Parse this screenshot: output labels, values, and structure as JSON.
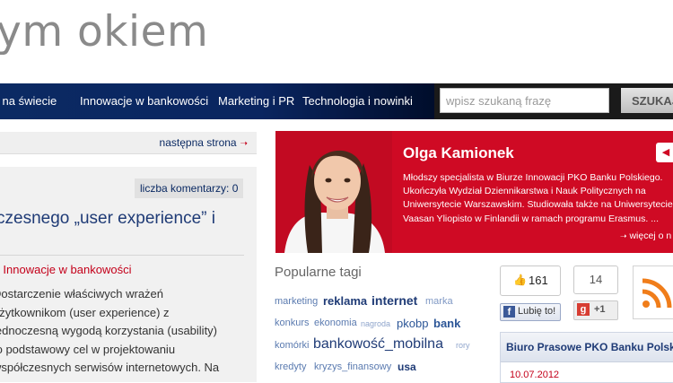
{
  "site": {
    "title": "ym okiem"
  },
  "nav": {
    "items": [
      "i na świecie",
      "Innowacje w bankowości",
      "Marketing i PR",
      "Technologia i nowinki"
    ]
  },
  "search": {
    "placeholder": "wpisz szukaną frazę",
    "button_label": "SZUKAJ"
  },
  "pager": {
    "next_label": "następna strona"
  },
  "article": {
    "comments_label": "liczba komentarzy: 0",
    "title": "czesnego „user experience” i",
    "category_prefix": "ii",
    "category": "Innowacje w bankowości",
    "excerpt_lines": [
      "Dostarczenie właściwych wrażeń",
      "użytkownikom (user experience) z",
      "jednoczesną wygodą korzystania (usability)",
      "to podstawowy cel w  projektowaniu",
      "współczesnych serwisów internetowych. Na"
    ]
  },
  "profile": {
    "name": "Olga Kamionek",
    "bio_lines": [
      "Młodszy specjalista w Biurze Innowacji PKO Banku Polskiego.",
      "Ukończyła Wydział Dziennikarstwa i Nauk Politycznych na",
      "Uniwersytecie Warszawskim. Studiowała także na Uniwersytecie",
      "Vaasan Yliopisto w Finlandii w ramach programu Erasmus. ..."
    ],
    "more_label": "więcej o n",
    "colors": {
      "background": "#cf0a24"
    }
  },
  "tags": {
    "title": "Popularne tagi",
    "items": [
      {
        "label": "marketing"
      },
      {
        "label": "reklama"
      },
      {
        "label": "internet"
      },
      {
        "label": "marka"
      },
      {
        "label": "konkurs"
      },
      {
        "label": "ekonomia"
      },
      {
        "label": "nagroda"
      },
      {
        "label": "pkobp"
      },
      {
        "label": "bank"
      },
      {
        "label": "komórki"
      },
      {
        "label": "bankowość_mobilna"
      },
      {
        "label": "rory"
      },
      {
        "label": "kredyty"
      },
      {
        "label": "kryzys_finansowy"
      },
      {
        "label": "usa"
      }
    ]
  },
  "social": {
    "like_count": "161",
    "like_label": "Lubię to!",
    "gplus_count": "14",
    "gplus_label": "+1",
    "rss_icon": "rss-icon"
  },
  "press": {
    "title": "Biuro Prasowe PKO Banku Polskie",
    "date": "10.07.2012"
  }
}
